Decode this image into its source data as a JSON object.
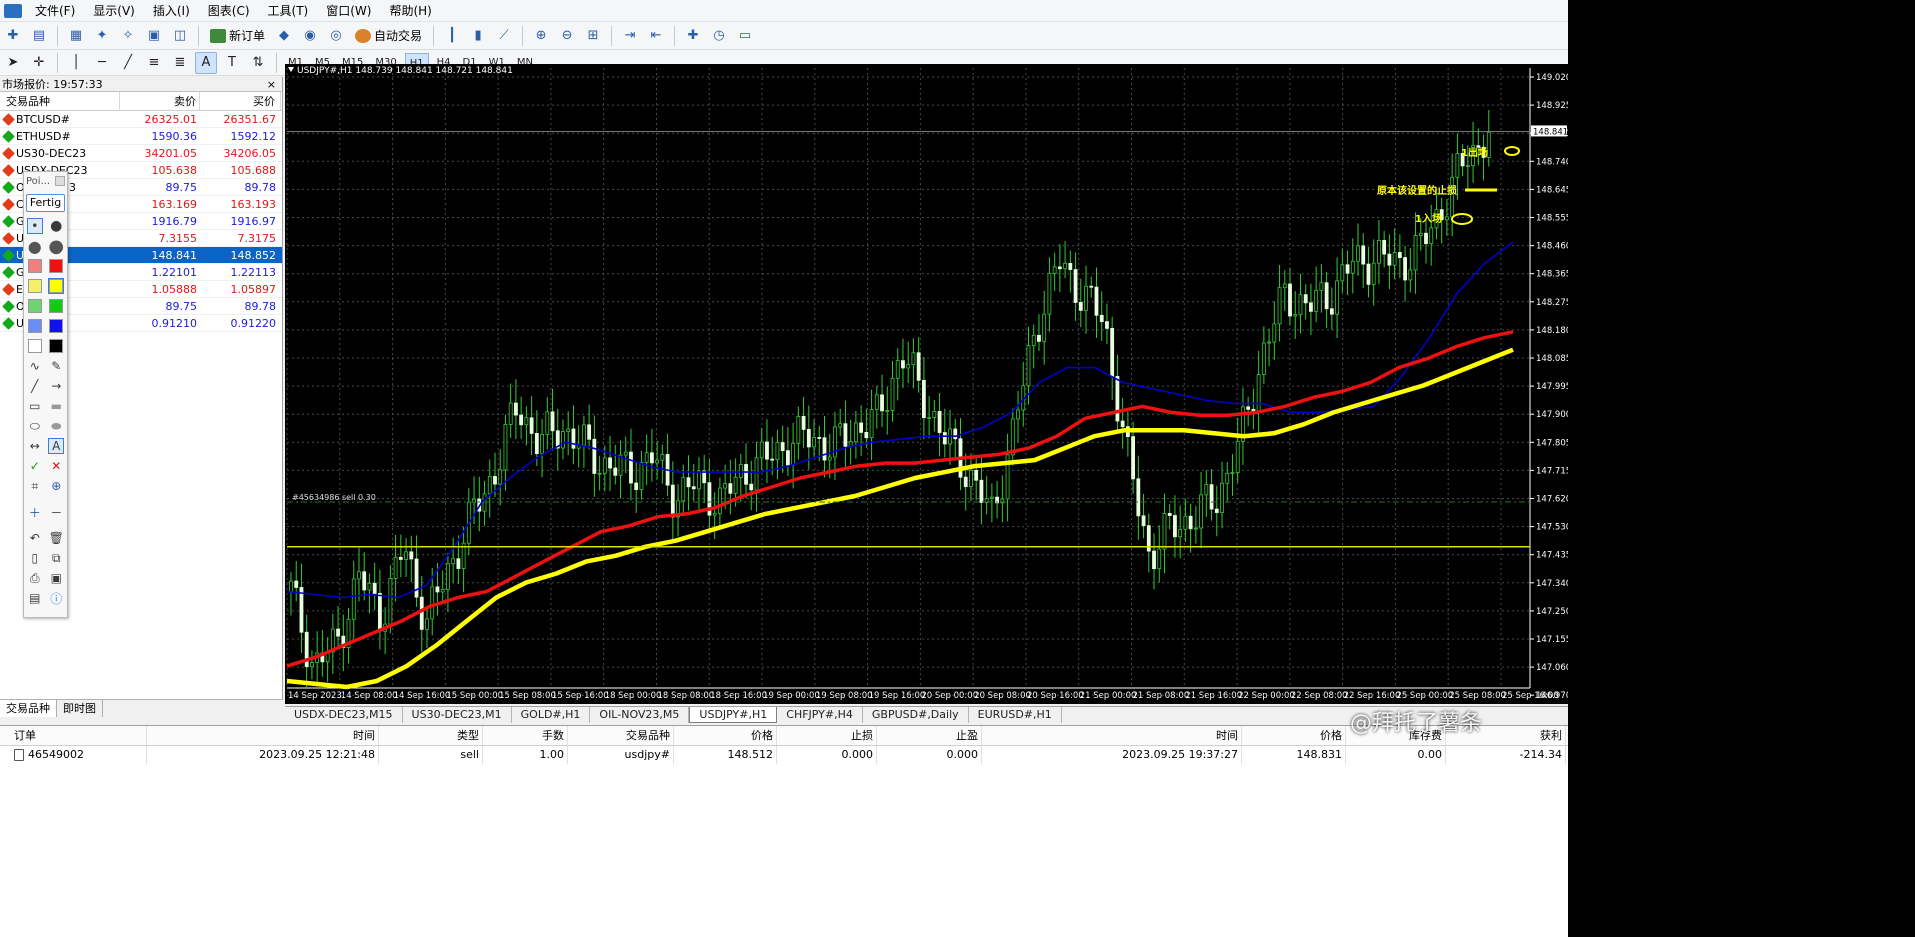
{
  "menu": [
    "文件(F)",
    "显示(V)",
    "插入(I)",
    "图表(C)",
    "工具(T)",
    "窗口(W)",
    "帮助(H)"
  ],
  "toolbar": {
    "new_order_label": "新订单",
    "autotrade_label": "自动交易",
    "timeframes": [
      "M1",
      "M5",
      "M15",
      "M30",
      "H1",
      "H4",
      "D1",
      "W1",
      "MN"
    ],
    "active_timeframe": "H1"
  },
  "market_watch": {
    "title": "市场报价: 19:57:33",
    "col_symbol": "交易品种",
    "col_bid": "卖价",
    "col_ask": "买价",
    "rows": [
      {
        "symbol": "BTCUSD#",
        "bid": "26325.01",
        "ask": "26351.67",
        "dir": "down"
      },
      {
        "symbol": "ETHUSD#",
        "bid": "1590.36",
        "ask": "1592.12",
        "dir": "up"
      },
      {
        "symbol": "US30-DEC23",
        "bid": "34201.05",
        "ask": "34206.05",
        "dir": "down"
      },
      {
        "symbol": "USDX-DEC23",
        "bid": "105.638",
        "ask": "105.688",
        "dir": "down"
      },
      {
        "symbol": "OIL-NOV23",
        "bid": "89.75",
        "ask": "89.78",
        "dir": "up"
      },
      {
        "symbol": "C",
        "bid": "163.169",
        "ask": "163.193",
        "dir": "down"
      },
      {
        "symbol": "G",
        "bid": "1916.79",
        "ask": "1916.97",
        "dir": "up"
      },
      {
        "symbol": "U",
        "bid": "7.3155",
        "ask": "7.3175",
        "dir": "down"
      },
      {
        "symbol": "U",
        "bid": "148.841",
        "ask": "148.852",
        "dir": "up",
        "selected": true
      },
      {
        "symbol": "G",
        "bid": "1.22101",
        "ask": "1.22113",
        "dir": "up"
      },
      {
        "symbol": "E",
        "bid": "1.05888",
        "ask": "1.05897",
        "dir": "down"
      },
      {
        "symbol": "O",
        "bid": "89.75",
        "ask": "89.78",
        "dir": "up"
      },
      {
        "symbol": "U",
        "bid": "0.91210",
        "ask": "0.91220",
        "dir": "up"
      }
    ],
    "tabs": [
      "交易品种",
      "即时图"
    ]
  },
  "palette": {
    "poi_label": "Poi...",
    "fertig_label": "Fertig",
    "colors": [
      "#f08080",
      "#ee1111",
      "#f5f06a",
      "#ffff00",
      "#6fd46f",
      "#11cc11",
      "#6a8ef5",
      "#1111ee",
      "#ffffff",
      "#000000"
    ]
  },
  "chart": {
    "title": "USDJPY#,H1  148.739 148.841 148.721 148.841",
    "order_label": "#45634986 sell 0.30",
    "annotations": {
      "exit": "1出场",
      "stop": "原本该设置的止损",
      "entry": "1入场"
    },
    "current_price_label": "148.841",
    "annotation_color": "#ffff00"
  },
  "chart_data": {
    "type": "line",
    "title": "USDJPY#,H1",
    "y_ticks": [
      "149.020",
      "148.925",
      "148.841",
      "148.740",
      "148.645",
      "148.555",
      "148.460",
      "148.365",
      "148.275",
      "148.180",
      "148.085",
      "147.995",
      "147.900",
      "147.805",
      "147.715",
      "147.620",
      "147.530",
      "147.435",
      "147.340",
      "147.250",
      "147.155",
      "147.060",
      "146.970"
    ],
    "x_ticks": [
      "14 Sep 2023",
      "14 Sep 08:00",
      "14 Sep 16:00",
      "15 Sep 00:00",
      "15 Sep 08:00",
      "15 Sep 16:00",
      "18 Sep 00:00",
      "18 Sep 08:00",
      "18 Sep 16:00",
      "19 Sep 00:00",
      "19 Sep 08:00",
      "19 Sep 16:00",
      "20 Sep 00:00",
      "20 Sep 08:00",
      "20 Sep 16:00",
      "21 Sep 00:00",
      "21 Sep 08:00",
      "21 Sep 16:00",
      "22 Sep 00:00",
      "22 Sep 08:00",
      "22 Sep 16:00",
      "25 Sep 00:00",
      "25 Sep 08:00",
      "25 Sep 16:00"
    ],
    "ylim": [
      146.97,
      149.02
    ],
    "close": [
      147.3,
      147.05,
      147.12,
      147.35,
      147.22,
      147.45,
      147.2,
      147.38,
      147.55,
      147.7,
      147.92,
      147.8,
      147.85,
      147.78,
      147.72,
      147.7,
      147.75,
      147.62,
      147.66,
      147.6,
      147.7,
      147.74,
      147.8,
      147.82,
      147.78,
      147.85,
      147.88,
      148.1,
      147.95,
      147.8,
      147.7,
      147.55,
      147.85,
      148.2,
      148.4,
      148.3,
      148.2,
      147.75,
      147.42,
      147.52,
      147.55,
      147.62,
      147.8,
      148.1,
      148.3,
      148.25,
      148.3,
      148.4,
      148.42,
      148.4,
      148.45,
      148.6,
      148.75,
      148.84
    ],
    "series": [
      {
        "name": "MA-blue",
        "color": "#0000cc",
        "values": [
          147.3,
          147.29,
          147.28,
          147.29,
          147.28,
          147.32,
          147.45,
          147.6,
          147.68,
          147.75,
          147.8,
          147.78,
          147.75,
          147.72,
          147.7,
          147.7,
          147.7,
          147.7,
          147.72,
          147.75,
          147.78,
          147.8,
          147.81,
          147.82,
          147.82,
          147.85,
          147.9,
          148.0,
          148.05,
          148.05,
          148.0,
          147.98,
          147.96,
          147.94,
          147.93,
          147.93,
          147.9,
          147.9,
          147.91,
          147.92,
          148.02,
          148.15,
          148.3,
          148.4,
          148.47
        ]
      },
      {
        "name": "MA-red",
        "color": "#ee1111",
        "values": [
          147.05,
          147.08,
          147.12,
          147.16,
          147.2,
          147.25,
          147.28,
          147.3,
          147.35,
          147.4,
          147.45,
          147.5,
          147.52,
          147.55,
          147.56,
          147.58,
          147.62,
          147.65,
          147.68,
          147.7,
          147.72,
          147.73,
          147.73,
          147.74,
          147.75,
          147.76,
          147.78,
          147.82,
          147.88,
          147.9,
          147.92,
          147.9,
          147.89,
          147.89,
          147.9,
          147.92,
          147.95,
          147.97,
          148.0,
          148.05,
          148.08,
          148.12,
          148.15,
          148.17
        ]
      },
      {
        "name": "MA-yellow",
        "color": "#ffff00",
        "values": [
          147.0,
          146.99,
          146.98,
          147.0,
          147.05,
          147.12,
          147.2,
          147.28,
          147.33,
          147.36,
          147.4,
          147.42,
          147.45,
          147.47,
          147.5,
          147.53,
          147.56,
          147.58,
          147.6,
          147.62,
          147.65,
          147.68,
          147.7,
          147.72,
          147.73,
          147.74,
          147.78,
          147.82,
          147.84,
          147.84,
          147.84,
          147.83,
          147.82,
          147.83,
          147.86,
          147.9,
          147.93,
          147.96,
          147.99,
          148.03,
          148.07,
          148.11
        ]
      }
    ],
    "hlines": [
      147.45,
      148.645
    ],
    "grid": true
  },
  "chart_tabs": [
    "USDX-DEC23,M15",
    "US30-DEC23,M1",
    "GOLD#,H1",
    "OIL-NOV23,M5",
    "USDJPY#,H1",
    "CHFJPY#,H4",
    "GBPUSD#,Daily",
    "EURUSD#,H1"
  ],
  "active_chart_tab": "USDJPY#,H1",
  "terminal": {
    "headers": [
      "订单",
      "时间",
      "类型",
      "手数",
      "交易品种",
      "价格",
      "止损",
      "止盈",
      "时间",
      "价格",
      "库存费",
      "获利"
    ],
    "row": [
      "46549002",
      "2023.09.25 12:21:48",
      "sell",
      "1.00",
      "usdjpy#",
      "148.512",
      "0.000",
      "0.000",
      "2023.09.25 19:37:27",
      "148.831",
      "0.00",
      "-214.34"
    ]
  },
  "watermark": "@拜托了薯条"
}
